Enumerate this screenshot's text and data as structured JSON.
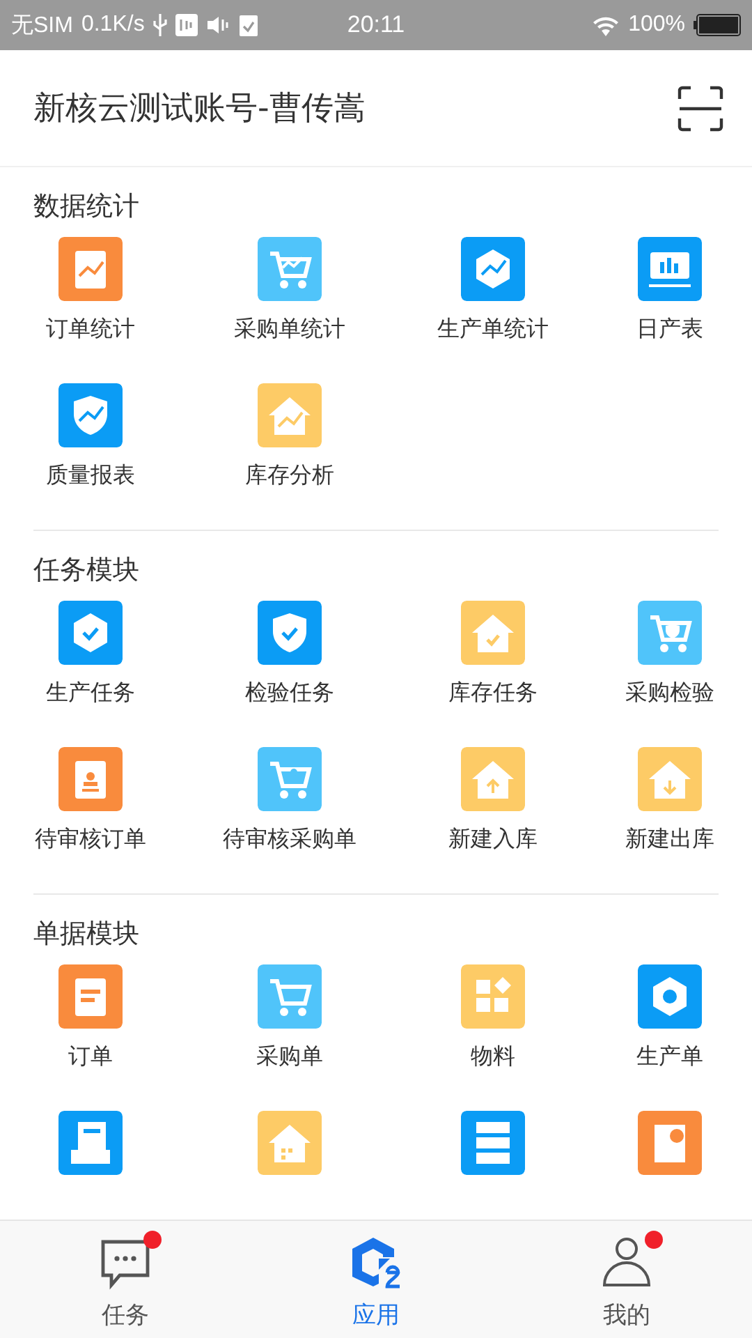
{
  "status_bar": {
    "carrier": "无SIM",
    "speed": "0.1K/s",
    "time": "20:11",
    "battery": "100%"
  },
  "header": {
    "title": "新核云测试账号-曹传嵩"
  },
  "sections": [
    {
      "title": "数据统计",
      "items": [
        {
          "label": "订单统计",
          "color": "#f98b3d",
          "kind": "clipboard-chart"
        },
        {
          "label": "采购单统计",
          "color": "#50c4fa",
          "kind": "cart-chart"
        },
        {
          "label": "生产单统计",
          "color": "#0b9cf5",
          "kind": "hexagon-chart"
        },
        {
          "label": "日产表",
          "color": "#0b9cf5",
          "kind": "monitor"
        },
        {
          "label": "质量报表",
          "color": "#0b9cf5",
          "kind": "shield-chart"
        },
        {
          "label": "库存分析",
          "color": "#fdcb66",
          "kind": "house-chart"
        }
      ]
    },
    {
      "title": "任务模块",
      "items": [
        {
          "label": "生产任务",
          "color": "#0b9cf5",
          "kind": "hexagon-check"
        },
        {
          "label": "检验任务",
          "color": "#0b9cf5",
          "kind": "shield-check"
        },
        {
          "label": "库存任务",
          "color": "#fdcb66",
          "kind": "house-check"
        },
        {
          "label": "采购检验",
          "color": "#50c4fa",
          "kind": "cart-shield"
        },
        {
          "label": "待审核订单",
          "color": "#f98b3d",
          "kind": "clipboard-stamp"
        },
        {
          "label": "待审核采购单",
          "color": "#50c4fa",
          "kind": "cart-stamp"
        },
        {
          "label": "新建入库",
          "color": "#fdcb66",
          "kind": "house-up"
        },
        {
          "label": "新建出库",
          "color": "#fdcb66",
          "kind": "house-down"
        }
      ]
    },
    {
      "title": "单据模块",
      "items": [
        {
          "label": "订单",
          "color": "#f98b3d",
          "kind": "clipboard-lines"
        },
        {
          "label": "采购单",
          "color": "#50c4fa",
          "kind": "cart"
        },
        {
          "label": "物料",
          "color": "#fdcb66",
          "kind": "blocks"
        },
        {
          "label": "生产单",
          "color": "#0b9cf5",
          "kind": "hexagon-dot"
        },
        {
          "color": "#0b9cf5",
          "kind": "tray"
        },
        {
          "color": "#fdcb66",
          "kind": "house-grid"
        },
        {
          "color": "#0b9cf5",
          "kind": "server"
        },
        {
          "color": "#f98b3d",
          "kind": "doc-clock"
        }
      ]
    }
  ],
  "tab_bar": [
    {
      "label": "任务",
      "selected": false,
      "badge": true,
      "kind": "chat"
    },
    {
      "label": "应用",
      "selected": true,
      "badge": false,
      "kind": "apps"
    },
    {
      "label": "我的",
      "selected": false,
      "badge": true,
      "kind": "person"
    }
  ]
}
